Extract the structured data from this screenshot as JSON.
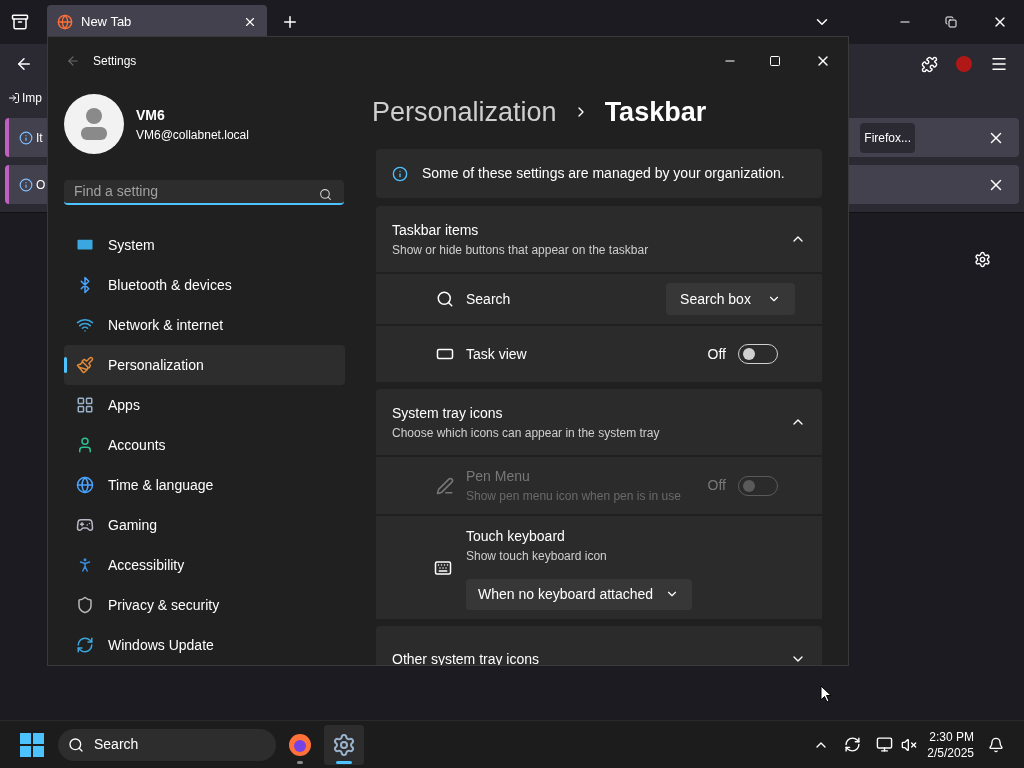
{
  "browser": {
    "tabs": [
      {
        "label": "New Tab",
        "selected": true
      }
    ],
    "bookmarks": [
      {
        "label": "Imp"
      }
    ],
    "notifications": [
      {
        "text": "It",
        "button": "Firefox..."
      },
      {
        "text": "O"
      }
    ]
  },
  "settings": {
    "title": "Settings",
    "user": {
      "name": "VM6",
      "email": "VM6@collabnet.local"
    },
    "search": {
      "placeholder": "Find a setting"
    },
    "nav": [
      {
        "label": "System",
        "selected": false
      },
      {
        "label": "Bluetooth & devices",
        "selected": false
      },
      {
        "label": "Network & internet",
        "selected": false
      },
      {
        "label": "Personalization",
        "selected": true
      },
      {
        "label": "Apps",
        "selected": false
      },
      {
        "label": "Accounts",
        "selected": false
      },
      {
        "label": "Time & language",
        "selected": false
      },
      {
        "label": "Gaming",
        "selected": false
      },
      {
        "label": "Accessibility",
        "selected": false
      },
      {
        "label": "Privacy & security",
        "selected": false
      },
      {
        "label": "Windows Update",
        "selected": false
      }
    ],
    "breadcrumb": [
      "Personalization",
      "Taskbar"
    ],
    "info": "Some of these settings are managed by your organization.",
    "sections": [
      {
        "title": "Taskbar items",
        "subtitle": "Show or hide buttons that appear on the taskbar",
        "expanded": true,
        "rows": [
          {
            "kind": "dropdown",
            "label": "Search",
            "value": "Search box",
            "disabled": false
          },
          {
            "kind": "toggle",
            "label": "Task view",
            "state_text": "Off",
            "on": false,
            "disabled": false
          }
        ]
      },
      {
        "title": "System tray icons",
        "subtitle": "Choose which icons can appear in the system tray",
        "expanded": true,
        "rows": [
          {
            "kind": "toggle",
            "label": "Pen Menu",
            "subtitle": "Show pen menu icon when pen is in use",
            "state_text": "Off",
            "on": false,
            "disabled": true
          },
          {
            "kind": "stacked_dropdown",
            "label": "Touch keyboard",
            "subtitle": "Show touch keyboard icon",
            "value": "When no keyboard attached",
            "disabled": false
          }
        ]
      },
      {
        "title": "Other system tray icons",
        "expanded": false
      }
    ]
  },
  "taskbar": {
    "search": "Search",
    "apps": [
      {
        "kind": "browser",
        "selected": false
      },
      {
        "kind": "settings",
        "selected": true
      }
    ],
    "time": "2:30 PM",
    "date": "2/5/2025"
  }
}
